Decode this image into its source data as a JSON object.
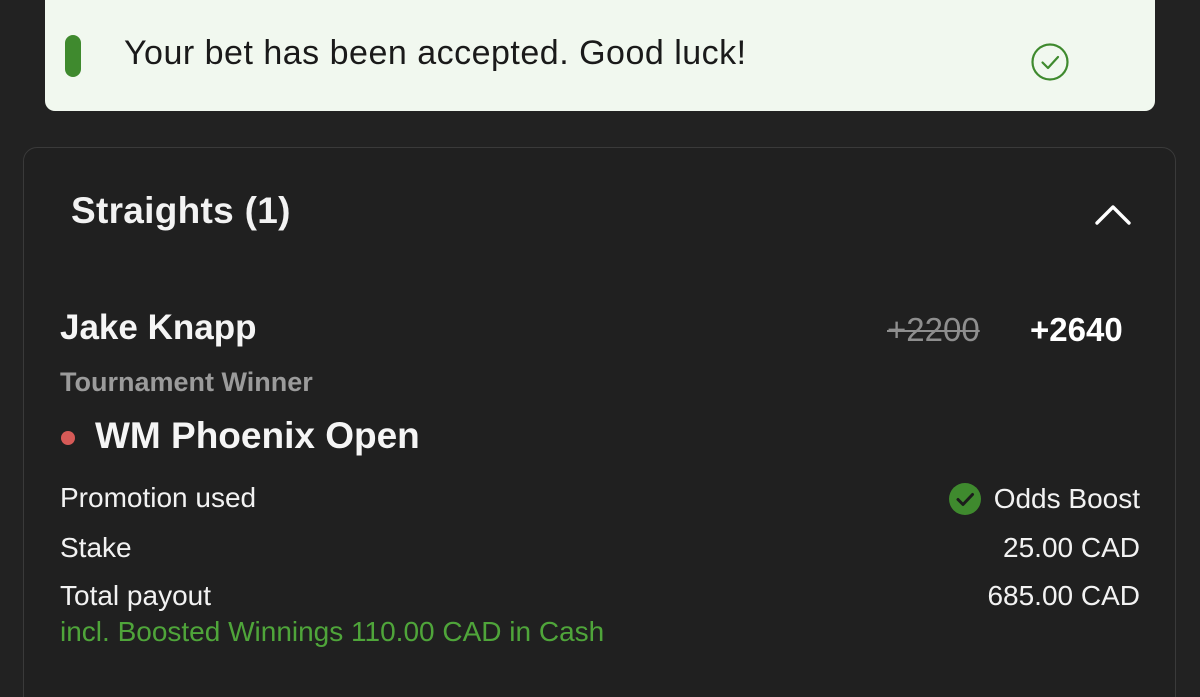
{
  "toast": {
    "message": "Your bet has been accepted. Good luck!",
    "accent_color": "#3f8a2e",
    "icon": "check-circle-icon"
  },
  "section": {
    "title": "Straights (1)",
    "collapse_icon": "chevron-up-icon"
  },
  "bet": {
    "selection": "Jake Knapp",
    "original_odds": "+2200",
    "boosted_odds": "+2640",
    "market": "Tournament Winner",
    "event": "WM Phoenix Open",
    "event_status_color": "#d65a57"
  },
  "details": {
    "promotion_label": "Promotion used",
    "promotion_value": "Odds Boost",
    "stake_label": "Stake",
    "stake_value": "25.00 CAD",
    "payout_label": "Total payout",
    "payout_value": "685.00 CAD",
    "boost_note": "incl. Boosted Winnings 110.00 CAD in Cash",
    "boost_note_color": "#4fa53a"
  }
}
